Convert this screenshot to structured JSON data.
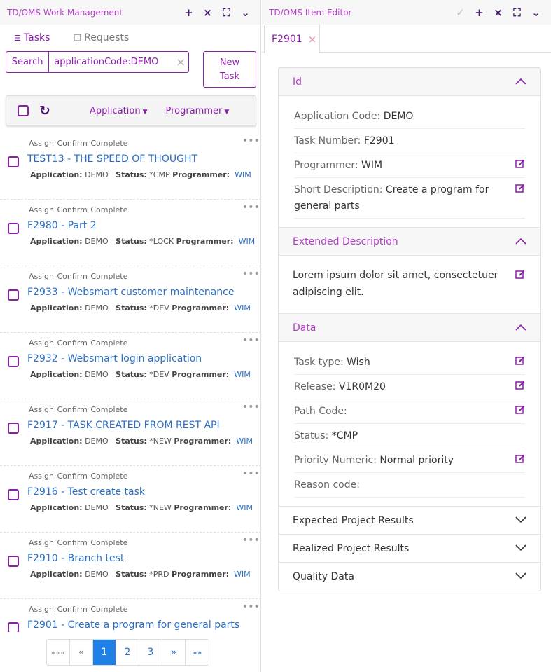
{
  "left": {
    "title": "TD/OMS Work Management",
    "tabs": [
      {
        "label": "Tasks"
      },
      {
        "label": "Requests"
      }
    ],
    "search": {
      "button": "Search",
      "value": "applicationCode:DEMO"
    },
    "new_task": {
      "line1": "New",
      "line2": "Task"
    },
    "toolbar": {
      "application": "Application",
      "programmer": "Programmer"
    },
    "tasks": [
      {
        "actions": "Assign Confirm Complete",
        "title": "TEST13 - THE SPEED OF THOUGHT",
        "app": "DEMO",
        "status": "*CMP",
        "programmer": "WIM"
      },
      {
        "actions": "Assign Confirm Complete",
        "title": "F2980 - Part 2",
        "app": "DEMO",
        "status": "*LOCK",
        "programmer": "WIM"
      },
      {
        "actions": "Assign Confirm Complete",
        "title": "F2933 - Websmart customer maintenance",
        "app": "DEMO",
        "status": "*DEV",
        "programmer": "WIM"
      },
      {
        "actions": "Assign Confirm Complete",
        "title": "F2932 - Websmart login application",
        "app": "DEMO",
        "status": "*DEV",
        "programmer": "WIM"
      },
      {
        "actions": "Assign Confirm Complete",
        "title": "F2917 - TASK CREATED FROM REST API",
        "app": "DEMO",
        "status": "*NEW",
        "programmer": "WIM"
      },
      {
        "actions": "Assign Confirm Complete",
        "title": "F2916 - Test create task",
        "app": "DEMO",
        "status": "*NEW",
        "programmer": "WIM"
      },
      {
        "actions": "Assign Confirm Complete",
        "title": "F2910 - Branch test",
        "app": "DEMO",
        "status": "*PRD",
        "programmer": "WIM"
      },
      {
        "actions": "Assign Confirm Complete",
        "title": "F2901 - Create a program for general parts",
        "app": "",
        "status": "",
        "programmer": ""
      }
    ],
    "meta_labels": {
      "application": "Application:",
      "status": "Status:",
      "programmer": "Programmer:"
    },
    "pager": {
      "first": "«««",
      "prev": "«",
      "p1": "1",
      "p2": "2",
      "p3": "3",
      "next": "»",
      "last": "»»"
    }
  },
  "right": {
    "title": "TD/OMS Item Editor",
    "doc_tab": "F2901",
    "sections": {
      "id": {
        "title": "Id",
        "fields": [
          {
            "label": "Application Code: ",
            "value": "DEMO"
          },
          {
            "label": "Task Number: ",
            "value": "F2901"
          },
          {
            "label": "Programmer: ",
            "value": "WIM"
          },
          {
            "label": "Short Description: ",
            "value": "Create a program for general parts"
          }
        ]
      },
      "ext": {
        "title": "Extended Description",
        "text": "Lorem ipsum dolor sit amet, consectetuer adipiscing elit."
      },
      "data": {
        "title": "Data",
        "fields": [
          {
            "label": "Task type: ",
            "value": "Wish"
          },
          {
            "label": "Release: ",
            "value": "V1R0M20"
          },
          {
            "label": "Path Code: ",
            "value": ""
          },
          {
            "label": "Status: ",
            "value": "*CMP"
          },
          {
            "label": "Priority Numeric: ",
            "value": "Normal priority"
          },
          {
            "label": "Reason code: ",
            "value": ""
          }
        ]
      },
      "expected": {
        "title": "Expected Project Results"
      },
      "realized": {
        "title": "Realized Project Results"
      },
      "quality": {
        "title": "Quality Data"
      }
    }
  },
  "colors": {
    "accent": "#8b1fa8",
    "link": "#2c6fc2",
    "active_page": "#1e7fe6"
  }
}
